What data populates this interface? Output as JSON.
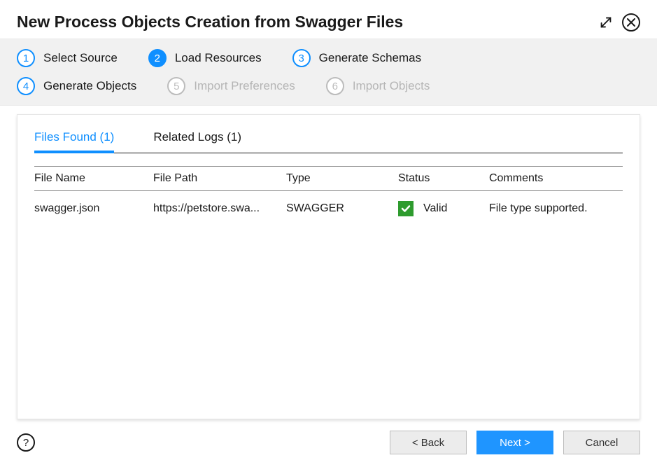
{
  "dialog": {
    "title": "New Process Objects Creation from Swagger Files"
  },
  "steps": [
    {
      "num": "1",
      "label": "Select Source",
      "state": "done"
    },
    {
      "num": "2",
      "label": "Load Resources",
      "state": "active"
    },
    {
      "num": "3",
      "label": "Generate Schemas",
      "state": "future"
    },
    {
      "num": "4",
      "label": "Generate Objects",
      "state": "future"
    },
    {
      "num": "5",
      "label": "Import Preferences",
      "state": "disabled"
    },
    {
      "num": "6",
      "label": "Import Objects",
      "state": "disabled"
    }
  ],
  "tabs": {
    "files": "Files Found (1)",
    "logs": "Related Logs (1)"
  },
  "table": {
    "headers": {
      "file_name": "File Name",
      "file_path": "File Path",
      "type": "Type",
      "status": "Status",
      "comments": "Comments"
    },
    "rows": [
      {
        "file_name": "swagger.json",
        "file_path": "https://petstore.swa...",
        "type": "SWAGGER",
        "status": "Valid",
        "comments": "File type supported."
      }
    ]
  },
  "footer": {
    "help": "?",
    "back": "< Back",
    "next": "Next >",
    "cancel": "Cancel"
  }
}
